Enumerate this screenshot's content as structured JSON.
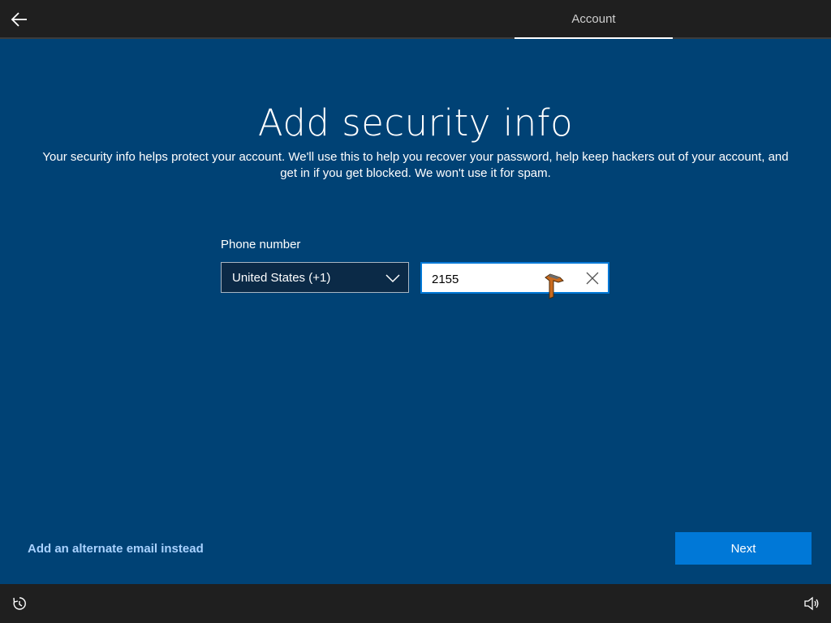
{
  "header": {
    "back_icon": "back-arrow-icon",
    "tab_label": "Account"
  },
  "main": {
    "title": "Add security info",
    "description": "Your security info helps protect your account. We'll use this to help you recover your password, help keep hackers out of your account, and get in if you get blocked. We won't use it for spam.",
    "phone_label": "Phone number",
    "country_selected": "United States (+1)",
    "phone_value": "2155"
  },
  "footer": {
    "alt_link": "Add an alternate email instead",
    "next_label": "Next"
  },
  "taskbar": {
    "left_icon": "ease-of-access-icon",
    "right_icon": "volume-icon"
  },
  "colors": {
    "background": "#004275",
    "accent": "#0078d7",
    "link": "#a9d2ff",
    "bar": "#1f1f1f"
  }
}
